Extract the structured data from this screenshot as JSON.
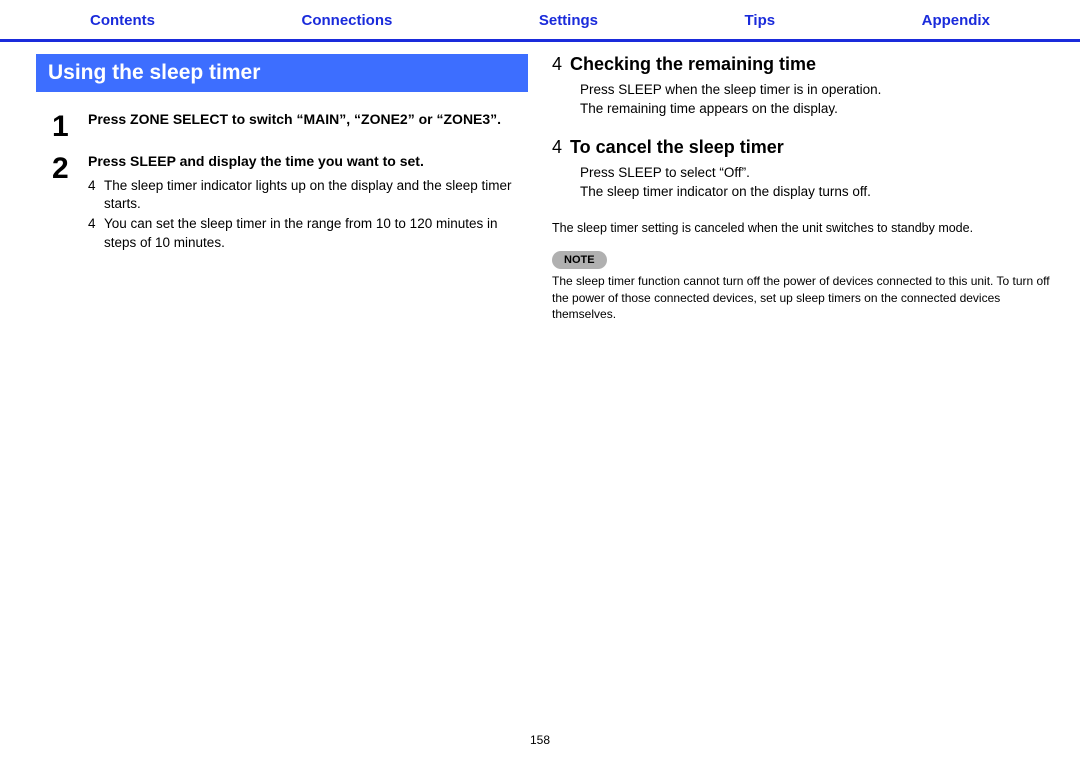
{
  "nav": {
    "contents": "Contents",
    "connections": "Connections",
    "settings": "Settings",
    "tips": "Tips",
    "appendix": "Appendix"
  },
  "left": {
    "title": "Using the sleep timer",
    "step1_num": "1",
    "step1_text": "Press ZONE SELECT to switch “MAIN”, “ZONE2” or “ZONE3”.",
    "step2_num": "2",
    "step2_text": "Press SLEEP and display the time you want to set.",
    "step2_b1_marker": "4",
    "step2_b1": "The sleep timer indicator lights up on the display and the sleep timer starts.",
    "step2_b2_marker": "4",
    "step2_b2": "You can set the sleep timer in the range from 10 to 120 minutes in steps of 10 minutes."
  },
  "right": {
    "h1_marker": "4",
    "h1": "Checking the remaining time",
    "h1_body1": "Press SLEEP when the sleep timer is in operation.",
    "h1_body2": "The remaining time appears on the display.",
    "h2_marker": "4",
    "h2": "To cancel the sleep timer",
    "h2_body1": "Press SLEEP to select “Off”.",
    "h2_body2": "The sleep timer indicator on the display turns off.",
    "plain": "The sleep timer setting is canceled when the unit switches to standby mode.",
    "note_label": "NOTE",
    "note_text": "The sleep timer function cannot turn off the power of devices connected to this unit. To turn off the power of those connected devices, set up sleep timers on the connected devices themselves."
  },
  "page": "158"
}
